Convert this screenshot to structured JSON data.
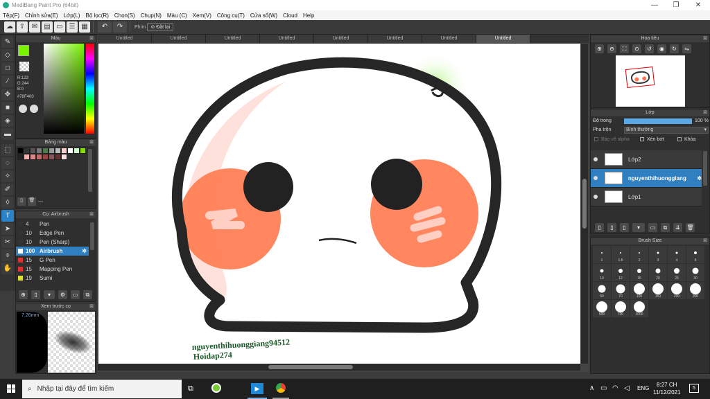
{
  "window": {
    "title": "MediBang Paint Pro (64bit)",
    "min": "—",
    "max": "❐",
    "close": "✕"
  },
  "menu": [
    "Tệp(F)",
    "Chỉnh sửa(E)",
    "Lớp(L)",
    "Bộ lọc(R)",
    "Chọn(S)",
    "Chụp(N)",
    "Màu (C)",
    "Xem(V)",
    "Công cụ(T)",
    "Cửa sổ(W)",
    "Cloud",
    "Help"
  ],
  "toolbar": {
    "keys_label": "Phím",
    "reset_label": "Đặt lại"
  },
  "color_panel": {
    "title": "Màu",
    "rgb": [
      "R:123",
      "G:244",
      "B:0"
    ],
    "hex": "#78F400",
    "fg": "#78F400",
    "bg": "#ffffff"
  },
  "palette_panel": {
    "title": "Bảng màu",
    "value": "---",
    "colors": [
      "#000000",
      "#333333",
      "#555555",
      "#777777",
      "#4a7a4a",
      "#999999",
      "#bbbbbb",
      "#ffcccc",
      "#ffffff",
      "#ccffcc",
      "#88dd00",
      "#222222",
      "#ffaaaa",
      "#dd8888",
      "#cc6666",
      "#994444",
      "#885555",
      "#663333",
      "#ffdddd"
    ]
  },
  "brush_panel": {
    "title": "Cọ: Airbrush",
    "items": [
      {
        "size": "4",
        "name": "Pen",
        "color": "#333333"
      },
      {
        "size": "10",
        "name": "Edge Pen",
        "color": "#333333"
      },
      {
        "size": "10",
        "name": "Pen (Sharp)",
        "color": "#333333"
      },
      {
        "size": "100",
        "name": "Airbrush",
        "color": "#2f7fc1",
        "selected": true
      },
      {
        "size": "15",
        "name": "G Pen",
        "color": "#dd3333"
      },
      {
        "size": "15",
        "name": "Mapping Pen",
        "color": "#dd3333"
      },
      {
        "size": "19",
        "name": "Sumi",
        "color": "#dddd33"
      }
    ]
  },
  "preview_panel": {
    "title": "Xem trước cọ",
    "size": "7.26mm"
  },
  "tabs": [
    "Untitled",
    "Untitled",
    "Untitled",
    "Untitled",
    "Untitled",
    "Untitled",
    "Untitled",
    "Untitled"
  ],
  "canvas": {
    "watermark_line1": "nguyenthihuonggiang94512",
    "watermark_line2": "Hoidap274"
  },
  "navigator": {
    "title": "Hoa tiêu"
  },
  "layer_panel": {
    "title": "Lớp",
    "opacity_label": "Độ trong",
    "opacity_value": "100 %",
    "blend_label": "Pha trộn",
    "blend_value": "Bình thường",
    "alpha_label": "Bảo vệ alpha",
    "clip_label": "Xén bớt",
    "lock_label": "Khóa",
    "layers": [
      {
        "name": "Lớp2"
      },
      {
        "name": "nguyenthihuonggiang",
        "selected": true
      },
      {
        "name": "Lớp1"
      }
    ]
  },
  "brushsize_panel": {
    "title": "Brush Size",
    "sizes": [
      "1",
      "1.5",
      "2",
      "3",
      "4",
      "5",
      "10",
      "12",
      "15",
      "20",
      "25",
      "30",
      "50",
      "70",
      "100",
      "150",
      "200",
      "300",
      "500",
      "700",
      "1000"
    ]
  },
  "taskbar": {
    "search_placeholder": "Nhập tại đây để tìm kiếm",
    "lang": "ENG",
    "time": "8:27 CH",
    "date": "11/12/2021",
    "notif": "5"
  }
}
